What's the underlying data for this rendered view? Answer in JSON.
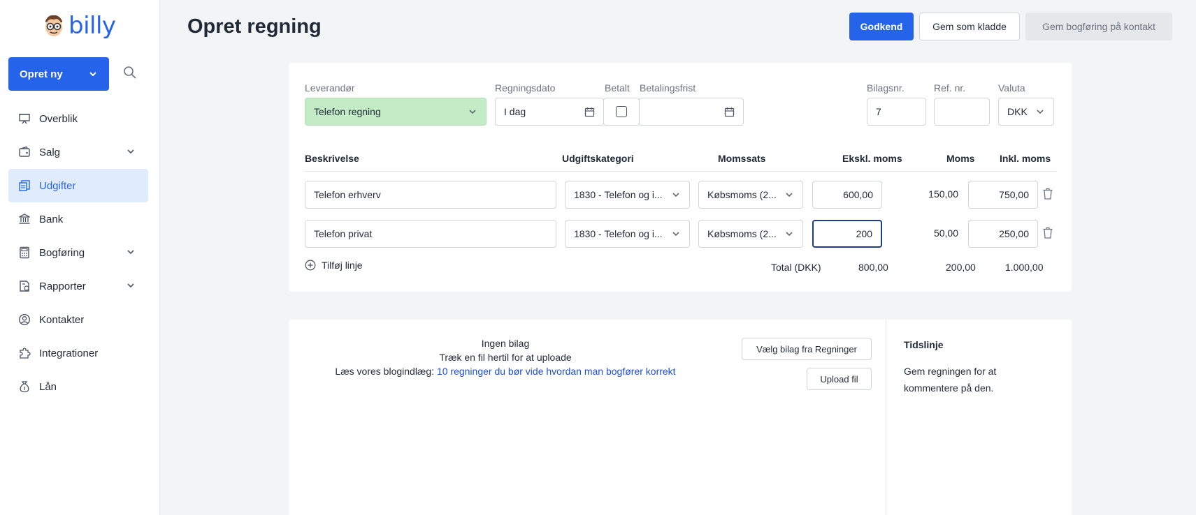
{
  "app": {
    "logo_text": "billy"
  },
  "sidebar": {
    "create_label": "Opret ny",
    "items": [
      {
        "label": "Overblik",
        "icon": "presentation-icon",
        "has_chevron": false,
        "active": false
      },
      {
        "label": "Salg",
        "icon": "wallet-icon",
        "has_chevron": true,
        "active": false
      },
      {
        "label": "Udgifter",
        "icon": "receipts-icon",
        "has_chevron": false,
        "active": true
      },
      {
        "label": "Bank",
        "icon": "bank-icon",
        "has_chevron": false,
        "active": false
      },
      {
        "label": "Bogføring",
        "icon": "calculator-icon",
        "has_chevron": true,
        "active": false
      },
      {
        "label": "Rapporter",
        "icon": "report-icon",
        "has_chevron": true,
        "active": false
      },
      {
        "label": "Kontakter",
        "icon": "user-circle-icon",
        "has_chevron": false,
        "active": false
      },
      {
        "label": "Integrationer",
        "icon": "puzzle-icon",
        "has_chevron": false,
        "active": false
      },
      {
        "label": "Lån",
        "icon": "money-bag-icon",
        "has_chevron": false,
        "active": false
      }
    ]
  },
  "header": {
    "title": "Opret regning",
    "approve_label": "Godkend",
    "draft_label": "Gem som kladde",
    "save_contact_label": "Gem bogføring på kontakt"
  },
  "bill": {
    "supplier_label": "Leverandør",
    "supplier_value": "Telefon regning",
    "date_label": "Regningsdato",
    "date_value": "I dag",
    "paid_label": "Betalt",
    "due_label": "Betalingsfrist",
    "due_value": "",
    "voucher_label": "Bilagsnr.",
    "voucher_value": "7",
    "ref_label": "Ref. nr.",
    "ref_value": "",
    "currency_label": "Valuta",
    "currency_value": "DKK"
  },
  "lines": {
    "headers": {
      "description": "Beskrivelse",
      "category": "Udgiftskategori",
      "vat_rate": "Momssats",
      "excl": "Ekskl. moms",
      "vat": "Moms",
      "incl": "Inkl. moms"
    },
    "rows": [
      {
        "description": "Telefon erhverv",
        "category": "1830 - Telefon og i...",
        "vat_rate": "Købsmoms (2...",
        "excl": "600,00",
        "vat": "150,00",
        "incl": "750,00"
      },
      {
        "description": "Telefon privat",
        "category": "1830 - Telefon og i...",
        "vat_rate": "Købsmoms (2...",
        "excl": "200",
        "vat": "50,00",
        "incl": "250,00"
      }
    ],
    "add_line_label": "Tilføj linje",
    "total_label": "Total (DKK)",
    "total_excl": "800,00",
    "total_vat": "200,00",
    "total_incl": "1.000,00"
  },
  "attachments": {
    "no_attachment": "Ingen bilag",
    "drag_text": "Træk en fil hertil for at uploade",
    "blog_prefix": "Læs vores blogindlæg:",
    "blog_link": "10 regninger du bør vide hvordan man bogfører korrekt",
    "choose_label": "Vælg bilag fra Regninger",
    "upload_label": "Upload fil"
  },
  "timeline": {
    "title": "Tidslinje",
    "text": "Gem regningen for at kommentere på den."
  },
  "colors": {
    "accent": "#2563eb",
    "supplier_bg": "#c3ebc6",
    "active_nav_bg": "#e0ecfb"
  }
}
